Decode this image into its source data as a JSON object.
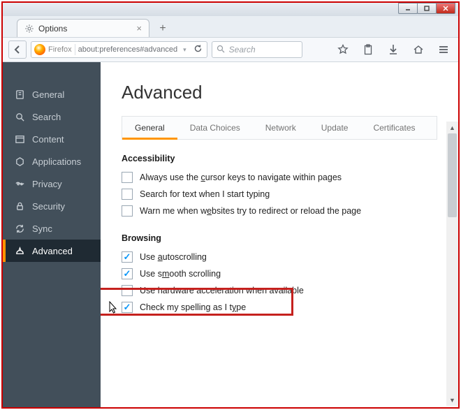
{
  "window": {
    "tab_title": "Options",
    "newtab_label": "+"
  },
  "navbar": {
    "brand": "Firefox",
    "url": "about:preferences#advanced",
    "search_placeholder": "Search"
  },
  "sidebar": {
    "items": [
      {
        "label": "General"
      },
      {
        "label": "Search"
      },
      {
        "label": "Content"
      },
      {
        "label": "Applications"
      },
      {
        "label": "Privacy"
      },
      {
        "label": "Security"
      },
      {
        "label": "Sync"
      },
      {
        "label": "Advanced"
      }
    ]
  },
  "main": {
    "heading": "Advanced",
    "tabs": [
      {
        "label": "General"
      },
      {
        "label": "Data Choices"
      },
      {
        "label": "Network"
      },
      {
        "label": "Update"
      },
      {
        "label": "Certificates"
      }
    ],
    "accessibility": {
      "title": "Accessibility",
      "opt1_pre": "Always use the ",
      "opt1_key": "c",
      "opt1_post": "ursor keys to navigate within pages",
      "opt2": "Search for text when I start typing",
      "opt3_pre": "Warn me when w",
      "opt3_key": "e",
      "opt3_post": "bsites try to redirect or reload the page"
    },
    "browsing": {
      "title": "Browsing",
      "opt1_pre": "Use ",
      "opt1_key": "a",
      "opt1_post": "utoscrolling",
      "opt2_pre": "Use s",
      "opt2_key": "m",
      "opt2_post": "ooth scrolling",
      "opt3": "Use hardware acceleration when available",
      "opt4_pre": "Check my spelling as I t",
      "opt4_key": "y",
      "opt4_post": "pe"
    }
  }
}
